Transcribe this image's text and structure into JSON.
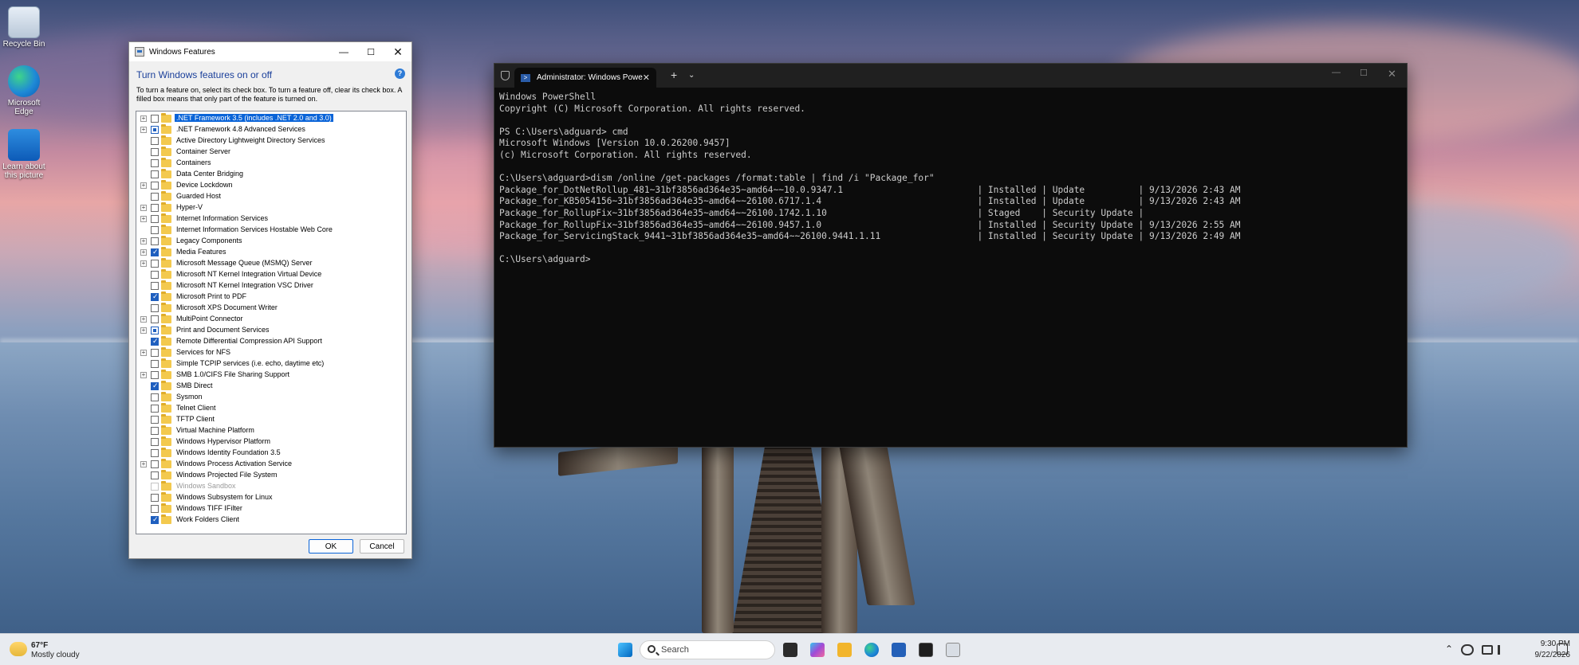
{
  "desktop": {
    "icons": [
      {
        "label": "Recycle Bin"
      },
      {
        "label": "Microsoft Edge"
      },
      {
        "label": "Learn about this picture"
      }
    ]
  },
  "features_dialog": {
    "title": "Windows Features",
    "heading": "Turn Windows features on or off",
    "description": "To turn a feature on, select its check box. To turn a feature off, clear its check box. A filled box means that only part of the feature is turned on.",
    "ok_label": "OK",
    "cancel_label": "Cancel",
    "items": [
      {
        "label": ".NET Framework 3.5 (includes .NET 2.0 and 3.0)",
        "expandable": true,
        "state": "off",
        "selected": true
      },
      {
        "label": ".NET Framework 4.8 Advanced Services",
        "expandable": true,
        "state": "partial"
      },
      {
        "label": "Active Directory Lightweight Directory Services",
        "expandable": false,
        "state": "off"
      },
      {
        "label": "Container Server",
        "expandable": false,
        "state": "off"
      },
      {
        "label": "Containers",
        "expandable": false,
        "state": "off"
      },
      {
        "label": "Data Center Bridging",
        "expandable": false,
        "state": "off"
      },
      {
        "label": "Device Lockdown",
        "expandable": true,
        "state": "off"
      },
      {
        "label": "Guarded Host",
        "expandable": false,
        "state": "off"
      },
      {
        "label": "Hyper-V",
        "expandable": true,
        "state": "off"
      },
      {
        "label": "Internet Information Services",
        "expandable": true,
        "state": "off"
      },
      {
        "label": "Internet Information Services Hostable Web Core",
        "expandable": false,
        "state": "off"
      },
      {
        "label": "Legacy Components",
        "expandable": true,
        "state": "off"
      },
      {
        "label": "Media Features",
        "expandable": true,
        "state": "on"
      },
      {
        "label": "Microsoft Message Queue (MSMQ) Server",
        "expandable": true,
        "state": "off"
      },
      {
        "label": "Microsoft NT Kernel Integration Virtual Device",
        "expandable": false,
        "state": "off"
      },
      {
        "label": "Microsoft NT Kernel Integration VSC Driver",
        "expandable": false,
        "state": "off"
      },
      {
        "label": "Microsoft Print to PDF",
        "expandable": false,
        "state": "on"
      },
      {
        "label": "Microsoft XPS Document Writer",
        "expandable": false,
        "state": "off"
      },
      {
        "label": "MultiPoint Connector",
        "expandable": true,
        "state": "off"
      },
      {
        "label": "Print and Document Services",
        "expandable": true,
        "state": "partial"
      },
      {
        "label": "Remote Differential Compression API Support",
        "expandable": false,
        "state": "on"
      },
      {
        "label": "Services for NFS",
        "expandable": true,
        "state": "off"
      },
      {
        "label": "Simple TCPIP services (i.e. echo, daytime etc)",
        "expandable": false,
        "state": "off"
      },
      {
        "label": "SMB 1.0/CIFS File Sharing Support",
        "expandable": true,
        "state": "off"
      },
      {
        "label": "SMB Direct",
        "expandable": false,
        "state": "on"
      },
      {
        "label": "Sysmon",
        "expandable": false,
        "state": "off"
      },
      {
        "label": "Telnet Client",
        "expandable": false,
        "state": "off"
      },
      {
        "label": "TFTP Client",
        "expandable": false,
        "state": "off"
      },
      {
        "label": "Virtual Machine Platform",
        "expandable": false,
        "state": "off"
      },
      {
        "label": "Windows Hypervisor Platform",
        "expandable": false,
        "state": "off"
      },
      {
        "label": "Windows Identity Foundation 3.5",
        "expandable": false,
        "state": "off"
      },
      {
        "label": "Windows Process Activation Service",
        "expandable": true,
        "state": "off"
      },
      {
        "label": "Windows Projected File System",
        "expandable": false,
        "state": "off"
      },
      {
        "label": "Windows Sandbox",
        "expandable": false,
        "state": "disabled"
      },
      {
        "label": "Windows Subsystem for Linux",
        "expandable": false,
        "state": "off"
      },
      {
        "label": "Windows TIFF IFilter",
        "expandable": false,
        "state": "off"
      },
      {
        "label": "Work Folders Client",
        "expandable": false,
        "state": "on"
      }
    ]
  },
  "terminal": {
    "tab_title": "Administrator: Windows Powe",
    "lines": [
      "Windows PowerShell",
      "Copyright (C) Microsoft Corporation. All rights reserved.",
      "",
      "PS C:\\Users\\adguard> cmd",
      "Microsoft Windows [Version 10.0.26200.9457]",
      "(c) Microsoft Corporation. All rights reserved.",
      "",
      "C:\\Users\\adguard>dism /online /get-packages /format:table | find /i \"Package_for\"",
      "Package_for_DotNetRollup_481~31bf3856ad364e35~amd64~~10.0.9347.1                         | Installed | Update          | 9/13/2026 2:43 AM",
      "Package_for_KB5054156~31bf3856ad364e35~amd64~~26100.6717.1.4                             | Installed | Update          | 9/13/2026 2:43 AM",
      "Package_for_RollupFix~31bf3856ad364e35~amd64~~26100.1742.1.10                            | Staged    | Security Update |",
      "Package_for_RollupFix~31bf3856ad364e35~amd64~~26100.9457.1.0                             | Installed | Security Update | 9/13/2026 2:55 AM",
      "Package_for_ServicingStack_9441~31bf3856ad364e35~amd64~~26100.9441.1.11                  | Installed | Security Update | 9/13/2026 2:49 AM",
      "",
      "C:\\Users\\adguard>"
    ]
  },
  "taskbar": {
    "weather_temp": "67°F",
    "weather_desc": "Mostly cloudy",
    "search_placeholder": "Search",
    "time": "9:30 PM",
    "date": "9/22/2026"
  }
}
